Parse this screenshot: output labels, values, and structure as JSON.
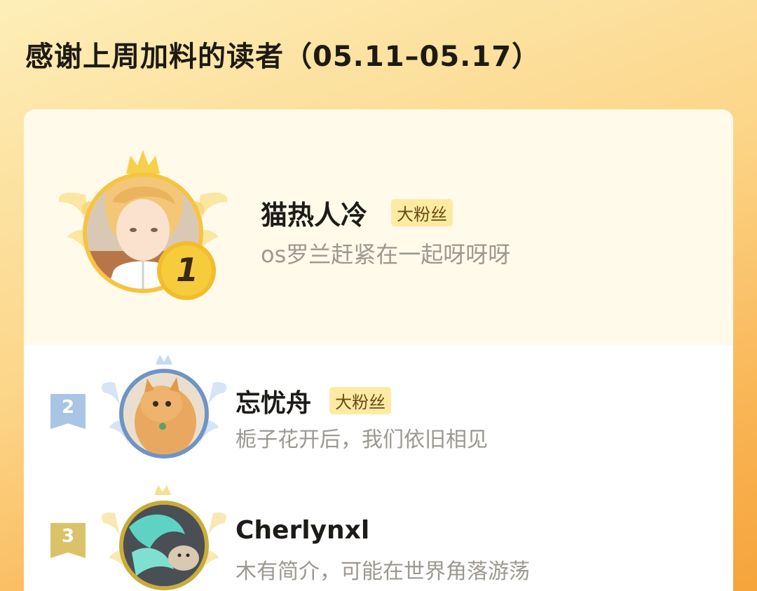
{
  "header": {
    "title": "感谢上周加料的读者（05.11–05.17）"
  },
  "colors": {
    "accent": "#f9b352",
    "badge_bg": "#fdeba4",
    "rank1_gold": "#f1c232",
    "rank2_blue": "#8fb4dc",
    "rank3_gold": "#dcc56c"
  },
  "readers": [
    {
      "rank": "1",
      "name": "猫热人冷",
      "badge": "大粉丝",
      "bio": "os罗兰赶紧在一起呀呀呀",
      "avatar": "anime-boy-avatar"
    },
    {
      "rank": "2",
      "name": "忘忧舟",
      "badge": "大粉丝",
      "bio": "栀子花开后，我们依旧相见",
      "avatar": "orange-cat-avatar"
    },
    {
      "rank": "3",
      "name": "Cherlynxl",
      "badge": "",
      "bio": "木有简介，可能在世界角落游荡",
      "avatar": "mermaid-cat-avatar"
    }
  ]
}
